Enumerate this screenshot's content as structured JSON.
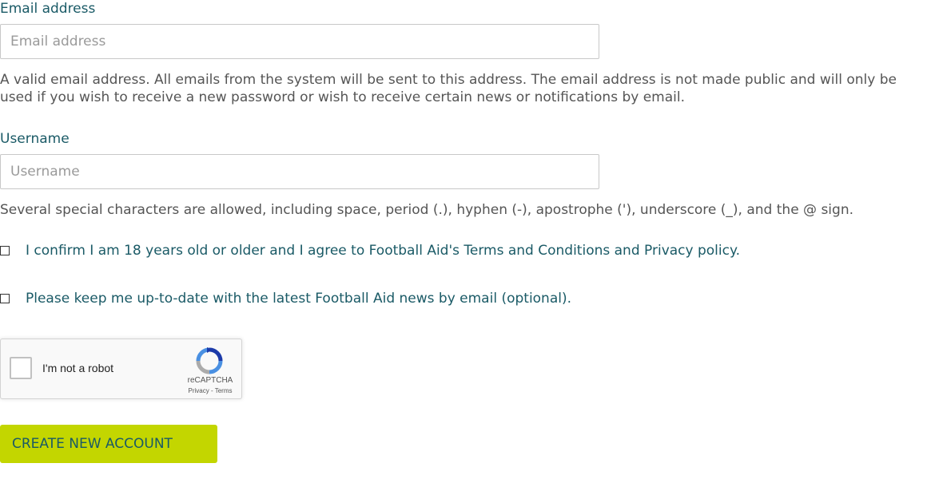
{
  "email": {
    "label": "Email address",
    "placeholder": "Email address",
    "value": "",
    "help": "A valid email address. All emails from the system will be sent to this address. The email address is not made public and will only be used if you wish to receive a new password or wish to receive certain news or notifications by email."
  },
  "username": {
    "label": "Username",
    "placeholder": "Username",
    "value": "",
    "help": "Several special characters are allowed, including space, period (.), hyphen (-), apostrophe ('), underscore (_), and the @ sign."
  },
  "checkboxes": [
    {
      "label": "I confirm I am 18 years old or older and I agree to Football Aid's Terms and Conditions and Privacy policy.",
      "checked": false
    },
    {
      "label": "Please keep me up-to-date with the latest Football Aid news by email (optional).",
      "checked": false
    }
  ],
  "recaptcha": {
    "text": "I'm not a robot",
    "brand": "reCAPTCHA",
    "links": "Privacy - Terms"
  },
  "submit": {
    "label": "CREATE NEW ACCOUNT"
  },
  "colors": {
    "accent_text": "#1a5a66",
    "button_bg": "#c3d600"
  }
}
